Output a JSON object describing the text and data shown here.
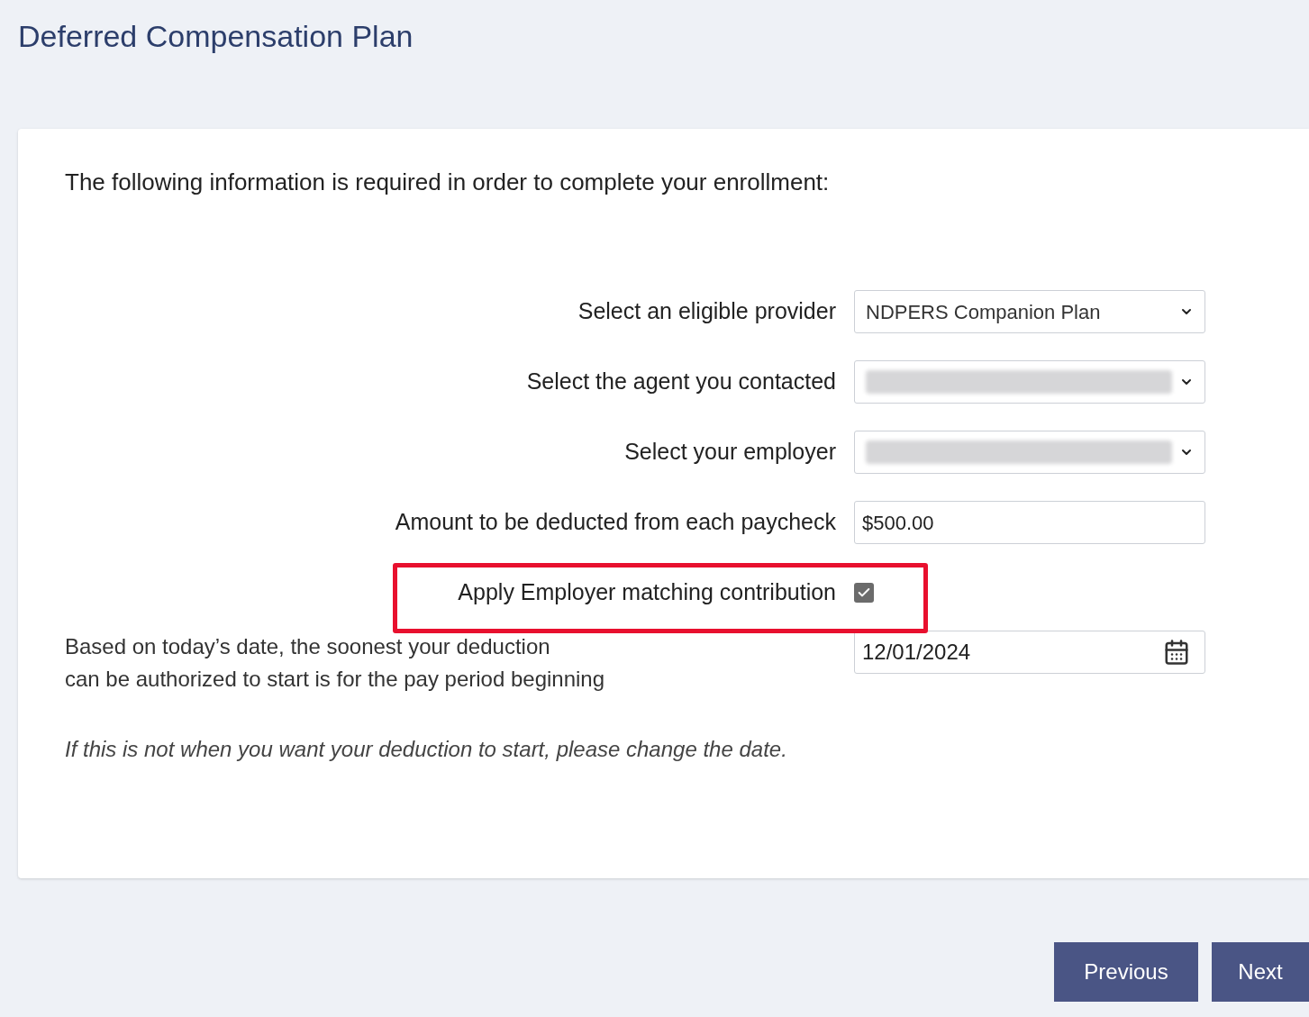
{
  "page_title": "Deferred Compensation Plan",
  "intro": "The following information is required in order to complete your enrollment:",
  "fields": [
    {
      "kind": "select",
      "label": "Select an eligible provider",
      "value": "NDPERS Companion Plan",
      "redacted": false,
      "highlighted": false
    },
    {
      "kind": "select",
      "label": "Select the agent you contacted",
      "redacted": true,
      "highlighted": false
    },
    {
      "kind": "select",
      "label": "Select your employer",
      "redacted": true,
      "highlighted": false
    },
    {
      "kind": "text",
      "label": "Amount to be deducted from each paycheck",
      "value": "$500.00",
      "highlighted": false
    },
    {
      "kind": "checkbox",
      "label": "Apply Employer matching contribution",
      "checked": true,
      "highlighted": true
    }
  ],
  "start_date": {
    "explanation_lines": [
      "Based on today’s date, the soonest your deduction",
      "can be authorized to start is for the pay period beginning"
    ],
    "value": "12/01/2024"
  },
  "note": "If this is not when you want your deduction to start, please change the date.",
  "buttons": [
    "Previous",
    "Next"
  ]
}
